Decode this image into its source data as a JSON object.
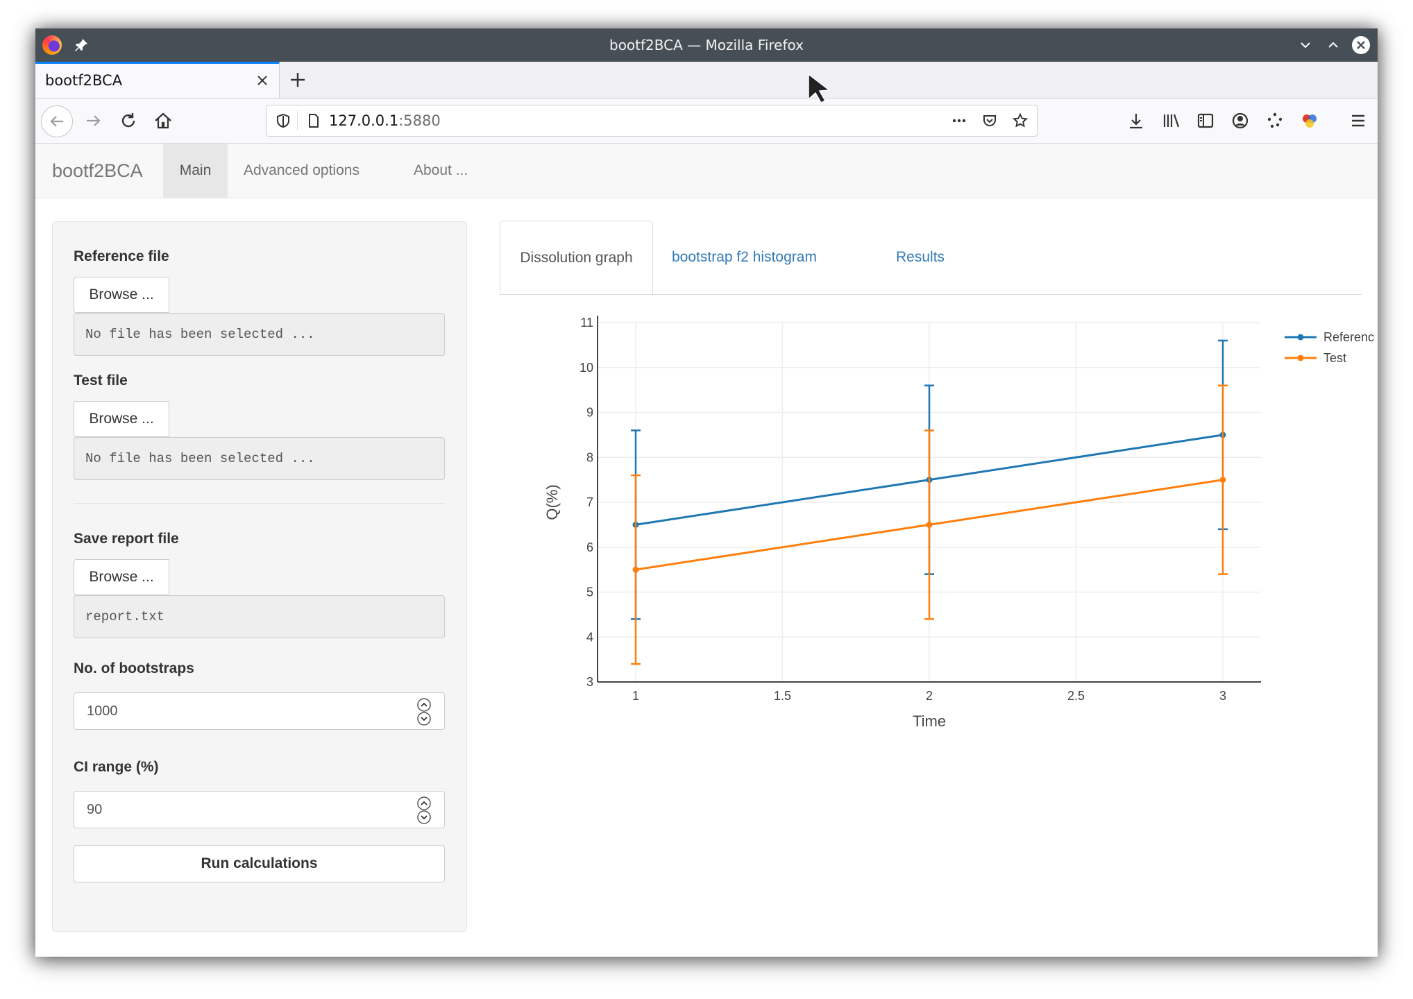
{
  "window": {
    "title": "bootf2BCA — Mozilla Firefox"
  },
  "browser": {
    "tab_title": "bootf2BCA",
    "url_host": "127.0.0.1",
    "url_port": ":5880"
  },
  "app": {
    "brand": "bootf2BCA",
    "nav": [
      {
        "label": "Main",
        "active": true
      },
      {
        "label": "Advanced options"
      },
      {
        "label": "About ..."
      }
    ]
  },
  "sidebar": {
    "reference_label": "Reference file",
    "reference_button": "Browse ...",
    "reference_value": "No file has been selected ...",
    "test_label": "Test file",
    "test_button": "Browse ...",
    "test_value": "No file has been selected ...",
    "report_label": "Save report file",
    "report_button": "Browse ...",
    "report_value": "report.txt",
    "bootstraps_label": "No. of bootstraps",
    "bootstraps_value": "1000",
    "ci_label": "CI range (%)",
    "ci_value": "90",
    "run_button": "Run calculations"
  },
  "main_tabs": [
    {
      "label": "Dissolution graph",
      "active": true
    },
    {
      "label": "bootstrap f2 histogram"
    },
    {
      "label": "Results"
    }
  ],
  "colors": {
    "reference": "#1f77b4",
    "test": "#ff7f0e"
  },
  "chart_data": {
    "type": "line",
    "xlabel": "Time",
    "ylabel": "Q(%)",
    "xlim": [
      0.87,
      3.13
    ],
    "ylim": [
      3,
      11
    ],
    "x_ticks": [
      "1",
      "1.5",
      "2",
      "2.5",
      "3"
    ],
    "x_tick_values": [
      1,
      1.5,
      2,
      2.5,
      3
    ],
    "y_ticks": [
      "3",
      "4",
      "5",
      "6",
      "7",
      "8",
      "9",
      "10",
      "11"
    ],
    "y_tick_values": [
      3,
      4,
      5,
      6,
      7,
      8,
      9,
      10,
      11
    ],
    "grid": true,
    "legend": "top-right",
    "x": [
      1,
      2,
      3
    ],
    "series": [
      {
        "name": "Reference",
        "values": [
          6.5,
          7.5,
          8.5
        ],
        "err_low": [
          4.4,
          5.4,
          6.4
        ],
        "err_high": [
          8.6,
          9.6,
          10.6
        ],
        "color": "#1f77b4"
      },
      {
        "name": "Test",
        "values": [
          5.5,
          6.5,
          7.5
        ],
        "err_low": [
          3.4,
          4.4,
          5.4
        ],
        "err_high": [
          7.6,
          8.6,
          9.6
        ],
        "color": "#ff7f0e"
      }
    ]
  }
}
